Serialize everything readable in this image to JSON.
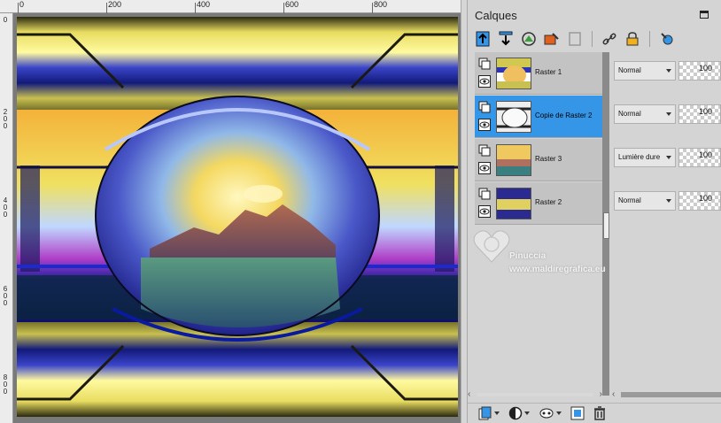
{
  "ruler": {
    "top_labels": [
      "0",
      "200",
      "400",
      "600",
      "800"
    ],
    "left_labels": [
      "0",
      "2 0 0",
      "4 0 0",
      "6 0 0",
      "8 0 0"
    ]
  },
  "canvas": {
    "name": "layered artwork: mountain lake sunset in sphere with yellow/blue bands"
  },
  "panel": {
    "title": "Calques",
    "toolbar": [
      {
        "icon": "new-raster-layer-icon"
      },
      {
        "icon": "new-vector-layer-icon"
      },
      {
        "icon": "new-mask-layer-icon"
      },
      {
        "icon": "new-adjustment-layer-icon"
      },
      {
        "icon": "promote-layer-icon"
      },
      {
        "icon": "link-icon"
      },
      {
        "icon": "lock-icon"
      },
      {
        "icon": "edit-selection-icon"
      }
    ],
    "layers": [
      {
        "name": "Raster 1",
        "blend": "Normal",
        "opacity": "100",
        "selected": false
      },
      {
        "name": "Copie de Raster 2",
        "blend": "Normal",
        "opacity": "100",
        "selected": true
      },
      {
        "name": "Raster 3",
        "blend": "Lumière dure",
        "opacity": "100",
        "selected": false
      },
      {
        "name": "Raster 2",
        "blend": "Normal",
        "opacity": "100",
        "selected": false
      }
    ],
    "watermark": {
      "name": "Pinuccia",
      "url": "www.maldiregrafica.eu"
    },
    "colors": {
      "selected": "#3596e8",
      "panel_bg": "#d4d4d4",
      "row_bg": "#c3c3c3"
    }
  }
}
